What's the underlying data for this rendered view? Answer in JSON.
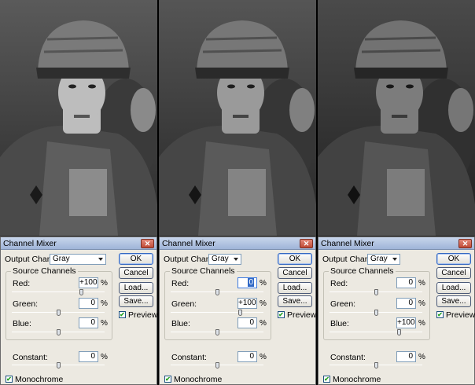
{
  "dialogs": [
    {
      "title": "Channel Mixer",
      "output_channel_label": "Output Channel:",
      "output_channel_value": "Gray",
      "source_channels_label": "Source Channels",
      "red_label": "Red:",
      "red_value": "+100",
      "red_level_percent": 100,
      "green_label": "Green:",
      "green_value": "0",
      "green_level_percent": 0,
      "blue_label": "Blue:",
      "blue_value": "0",
      "blue_level_percent": 0,
      "constant_label": "Constant:",
      "constant_value": "0",
      "constant_level_percent": 0,
      "percent_sign": "%",
      "ok_label": "OK",
      "cancel_label": "Cancel",
      "load_label": "Load...",
      "save_label": "Save...",
      "preview_label": "Preview",
      "preview_checked": true,
      "monochrome_label": "Monochrome",
      "monochrome_checked": true,
      "focused_field": ""
    },
    {
      "title": "Channel Mixer",
      "output_channel_label": "Output Channel:",
      "output_channel_value": "Gray",
      "source_channels_label": "Source Channels",
      "red_label": "Red:",
      "red_value": "0",
      "red_level_percent": 0,
      "green_label": "Green:",
      "green_value": "+100",
      "green_level_percent": 100,
      "blue_label": "Blue:",
      "blue_value": "0",
      "blue_level_percent": 0,
      "constant_label": "Constant:",
      "constant_value": "0",
      "constant_level_percent": 0,
      "percent_sign": "%",
      "ok_label": "OK",
      "cancel_label": "Cancel",
      "load_label": "Load...",
      "save_label": "Save...",
      "preview_label": "Preview",
      "preview_checked": true,
      "monochrome_label": "Monochrome",
      "monochrome_checked": true,
      "focused_field": "red"
    },
    {
      "title": "Channel Mixer",
      "output_channel_label": "Output Channel:",
      "output_channel_value": "Gray",
      "source_channels_label": "Source Channels",
      "red_label": "Red:",
      "red_value": "0",
      "red_level_percent": 0,
      "green_label": "Green:",
      "green_value": "0",
      "green_level_percent": 0,
      "blue_label": "Blue:",
      "blue_value": "+100",
      "blue_level_percent": 100,
      "constant_label": "Constant:",
      "constant_value": "0",
      "constant_level_percent": 0,
      "percent_sign": "%",
      "ok_label": "OK",
      "cancel_label": "Cancel",
      "load_label": "Load...",
      "save_label": "Save...",
      "preview_label": "Preview",
      "preview_checked": true,
      "monochrome_label": "Monochrome",
      "monochrome_checked": true,
      "focused_field": ""
    }
  ],
  "photos": [
    {
      "subject": "soldier-portrait",
      "tone": "#bdbdbd"
    },
    {
      "subject": "soldier-portrait",
      "tone": "#9a9a9a"
    },
    {
      "subject": "soldier-portrait",
      "tone": "#7c7c7c"
    }
  ],
  "colors": {
    "dialog_bg": "#ece9e1",
    "titlebar": "#9fb4d8",
    "close_button": "#c04a36",
    "input_border": "#7f9db9",
    "checkmark": "#21a121",
    "focus_highlight": "#3169c6"
  },
  "icons": {
    "close": "close-icon",
    "dropdown": "chevron-down-icon",
    "check": "checkmark-icon"
  }
}
